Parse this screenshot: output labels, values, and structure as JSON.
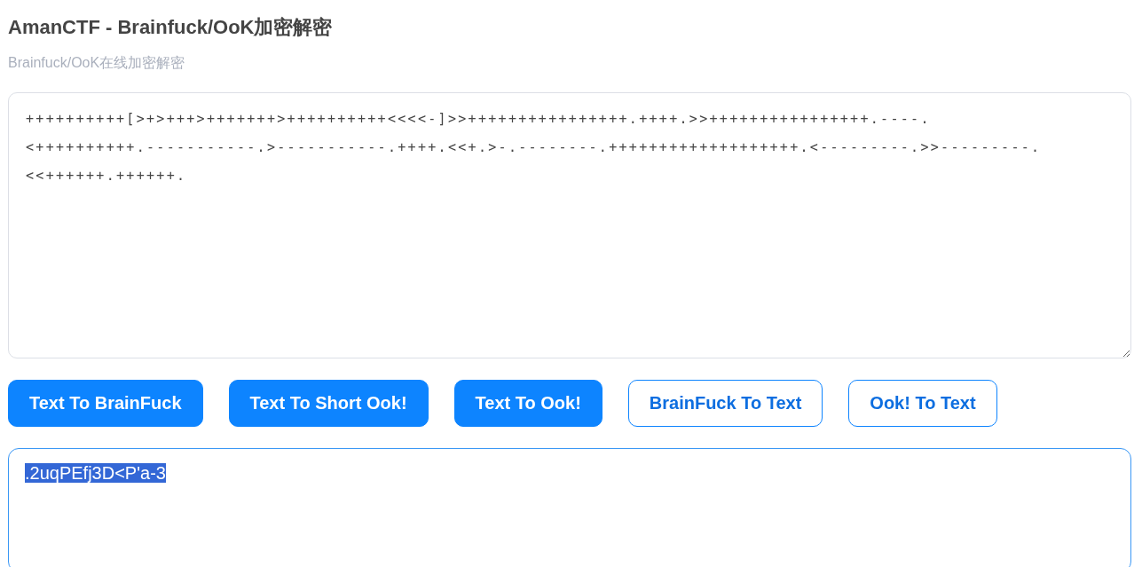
{
  "title": "AmanCTF - Brainfuck/OoK加密解密",
  "subtitle": "Brainfuck/OoK在线加密解密",
  "input": {
    "lines": [
      "++++++++++[>+>+++>+++++++>++++++++++<<<<-]>>++++++++++++++++.++++.>>++++++++++++++++.----.",
      "<++++++++++.-----------.>-----------.++++.<<+.>-.--------.+++++++++++++++++++.<---------.>>---------.",
      "<<++++++.++++++."
    ]
  },
  "buttons": [
    {
      "label": "Text To BrainFuck",
      "kind": "filled"
    },
    {
      "label": "Text To Short Ook!",
      "kind": "filled"
    },
    {
      "label": "Text To Ook!",
      "kind": "filled"
    },
    {
      "label": "BrainFuck To Text",
      "kind": "outline"
    },
    {
      "label": "Ook! To Text",
      "kind": "outline"
    }
  ],
  "output": {
    "value": ".2uqPEfj3D<P'a-3",
    "focused": true,
    "highlighted": true
  }
}
